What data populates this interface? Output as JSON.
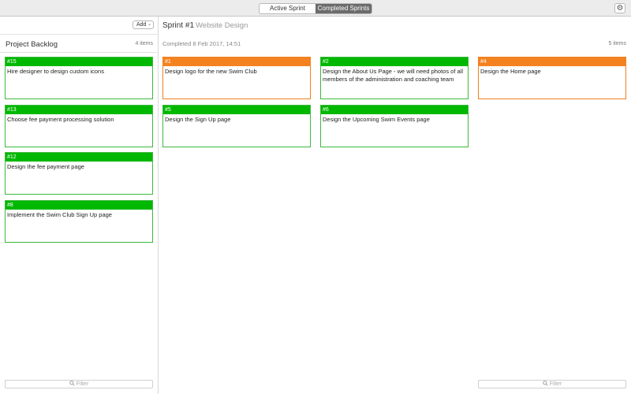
{
  "toolbar": {
    "segments": [
      {
        "label": "Active Sprint"
      },
      {
        "label": "Completed Sprints"
      }
    ],
    "settings_icon": "gear-icon"
  },
  "backlog": {
    "add_label": "Add",
    "title": "Project Backlog",
    "count": "4 items",
    "filter_placeholder": "Filter",
    "cards": [
      {
        "id": "#15",
        "text": "Hire designer to design custom icons",
        "status": "green"
      },
      {
        "id": "#13",
        "text": "Choose fee payment processing solution",
        "status": "green"
      },
      {
        "id": "#12",
        "text": "Design the fee payment page",
        "status": "green"
      },
      {
        "id": "#8",
        "text": "Implement the Swim Club Sign Up page",
        "status": "green"
      }
    ]
  },
  "sprint": {
    "title": "Sprint #1",
    "subtitle": "Website Design",
    "completed": "Completed 8 Feb 2017, 14:51",
    "count": "5 items",
    "filter_placeholder": "Filter",
    "cards": [
      {
        "id": "#1",
        "text": "Design logo for the new Swim Club",
        "status": "orange"
      },
      {
        "id": "#2",
        "text": "Design the About Us Page - we will need photos of all members of the administration and coaching team",
        "status": "green"
      },
      {
        "id": "#4",
        "text": "Design the Home page",
        "status": "orange"
      },
      {
        "id": "#5",
        "text": "Design the Sign Up page",
        "status": "green"
      },
      {
        "id": "#6",
        "text": "Design the Upcoming Swim Events page",
        "status": "green"
      }
    ]
  },
  "colors": {
    "green": "#00b800",
    "orange": "#f58220"
  }
}
